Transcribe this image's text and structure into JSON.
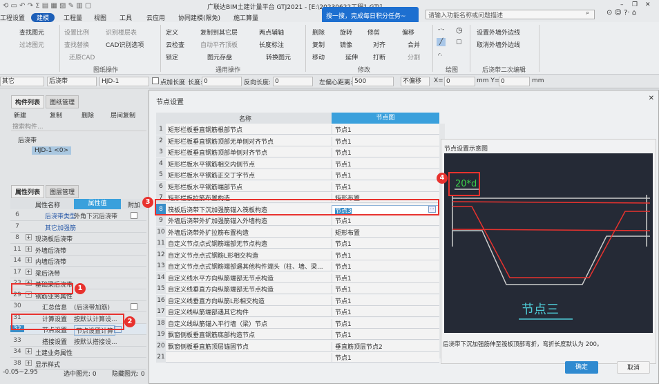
{
  "app": {
    "title": "广联达BIM土建计量平台 GTJ2021 - [E:\\20230622工程1.GTJ]"
  },
  "tabs": [
    "工程设置",
    "建模",
    "工程量",
    "视图",
    "工具",
    "云应用",
    "协同建模(限免)",
    "施工算量"
  ],
  "active_tab": "建模",
  "promo_banner": "搜一搜，完成每日积分任务~",
  "search": {
    "placeholder": "请输入功能名称或问题描述"
  },
  "ribbon": {
    "select_group": [
      "查找图元",
      "过滤图元"
    ],
    "drawing_ops": {
      "items": [
        "设置比例",
        "识别楼层表",
        "查找替换",
        "CAD识别选项",
        "还原CAD"
      ],
      "label": "图纸操作"
    },
    "general_ops": {
      "items": [
        "定义",
        "复制到其它层",
        "两点辅轴",
        "云检查",
        "自动平齐顶板",
        "长度标注",
        "锁定",
        "图元存盘",
        "转换图元"
      ],
      "label": "通用操作"
    },
    "modify": {
      "items": [
        "删除",
        "旋转",
        "修剪",
        "偏移",
        "复制",
        "镜像",
        "对齐",
        "合并",
        "移动",
        "延伸",
        "打断",
        "分割"
      ],
      "label": "修改"
    },
    "draw": {
      "label": "绘图"
    },
    "post_pour": {
      "items": [
        "设置外墙外边线",
        "取消外墙外边线"
      ],
      "label": "后浇带二次编辑"
    }
  },
  "toolbar": {
    "combo1": "其它",
    "combo2": "后浇带",
    "combo3": "HJD-1",
    "add_length": "点加长度",
    "length_label": "长度:",
    "length": "0",
    "rev_label": "反向长度:",
    "rev": "0",
    "offset_label": "左偏心距离:",
    "offset": "500",
    "offset_mode": "不偏移",
    "x_label": "X=",
    "x": "0",
    "y_label": "mm Y=",
    "y": "0",
    "unit": "mm"
  },
  "component_panel": {
    "tabs": [
      "构件列表",
      "图纸管理"
    ],
    "actions": [
      "新建",
      "复制",
      "删除",
      "层间复制"
    ],
    "search_placeholder": "搜索构件...",
    "tree_root": "后浇带",
    "tree_item": "HJD-1 <0>"
  },
  "property_panel": {
    "tabs": [
      "属性列表",
      "图层管理"
    ],
    "headers": [
      "属性名称",
      "属性值",
      "附加"
    ],
    "rows": [
      {
        "n": "6",
        "k": "后浇带类型",
        "v": "外角下沉后浇带",
        "check": true
      },
      {
        "n": "7",
        "k": "其它加强筋",
        "v": ""
      },
      {
        "n": "8",
        "k": "现浇板后浇带",
        "v": "",
        "exp": "+"
      },
      {
        "n": "11",
        "k": "外墙后浇带",
        "v": "",
        "exp": "+"
      },
      {
        "n": "14",
        "k": "内墙后浇带",
        "v": "",
        "exp": "+"
      },
      {
        "n": "17",
        "k": "梁后浇带",
        "v": "",
        "exp": "+"
      },
      {
        "n": "23",
        "k": "基础梁后浇带",
        "v": "",
        "exp": "+"
      },
      {
        "n": "29",
        "k": "钢筋业务属性",
        "v": "",
        "exp": "-"
      },
      {
        "n": "30",
        "k": "汇总信息",
        "v": "(后浇带加筋)",
        "check": true
      },
      {
        "n": "31",
        "k": "计算设置",
        "v": "按默认计算设..."
      },
      {
        "n": "32",
        "k": "节点设置",
        "v": "节点设置计算"
      },
      {
        "n": "33",
        "k": "搭接设置",
        "v": "按默认搭接设..."
      },
      {
        "n": "34",
        "k": "土建业务属性",
        "v": "",
        "exp": "+"
      },
      {
        "n": "38",
        "k": "显示样式",
        "v": "",
        "exp": "+"
      }
    ]
  },
  "status": {
    "range": "-0.05~2.95",
    "selected": "选中图元: 0",
    "hidden": "隐藏图元: 0"
  },
  "dialog": {
    "title": "节点设置",
    "headers": [
      "名称",
      "节点图"
    ],
    "rows": [
      {
        "n": "1",
        "k": "矩形栏板垂直钢筋根部节点",
        "v": "节点1"
      },
      {
        "n": "2",
        "k": "矩形栏板垂直钢筋顶部无单侧对齐节点",
        "v": "节点1"
      },
      {
        "n": "3",
        "k": "矩形栏板垂直钢筋顶部单侧对齐节点",
        "v": "节点1"
      },
      {
        "n": "4",
        "k": "矩形栏板水平钢筋相交内侧节点",
        "v": "节点1"
      },
      {
        "n": "5",
        "k": "矩形栏板水平钢筋正交丁字节点",
        "v": "节点1"
      },
      {
        "n": "6",
        "k": "矩形栏板水平钢筋端部节点",
        "v": "节点1"
      },
      {
        "n": "7",
        "k": "矩形栏板拉筋布置构造",
        "v": "矩形布置"
      },
      {
        "n": "8",
        "k": "筏板后浇带下沉加强筋锚入筏板构造",
        "v": "节点3"
      },
      {
        "n": "9",
        "k": "外墙后浇带外扩加强筋锚入外墙构造",
        "v": "节点1"
      },
      {
        "n": "10",
        "k": "外墙后浇带外扩拉筋布置构造",
        "v": "矩形布置"
      },
      {
        "n": "11",
        "k": "自定义节点点式钢筋端部无节点构造",
        "v": "节点1"
      },
      {
        "n": "12",
        "k": "自定义节点点式钢筋L形相交构造",
        "v": "节点1"
      },
      {
        "n": "13",
        "k": "自定义节点点式钢筋端部遇其他构件端头（柱、墙、梁...",
        "v": "节点1"
      },
      {
        "n": "14",
        "k": "自定义线水平方向纵筋端部无节点构造",
        "v": "节点1"
      },
      {
        "n": "15",
        "k": "自定义线垂直方向纵筋端部无节点构造",
        "v": "节点1"
      },
      {
        "n": "16",
        "k": "自定义线垂直方向纵筋L形相交构造",
        "v": "节点1"
      },
      {
        "n": "17",
        "k": "自定义线纵筋端部遇其它构件",
        "v": "节点1"
      },
      {
        "n": "18",
        "k": "自定义线纵筋锚入平行墙（梁）节点",
        "v": "节点1"
      },
      {
        "n": "19",
        "k": "飘窗侧板垂直钢筋底部构造节点",
        "v": "节点1"
      },
      {
        "n": "20",
        "k": "飘窗侧板垂直筋顶层锚固节点",
        "v": "垂直筋顶层节点2"
      },
      {
        "n": "21",
        "k": "",
        "v": "节点1"
      }
    ],
    "preview_title": "节点设置示意图",
    "dim_label": "20*d",
    "node_name": "节点三",
    "caption": "后浇带下沉加强筋伸至筏板顶部弯折，弯折长度默认为 200。",
    "ok": "确定",
    "cancel": "取消"
  },
  "annotations": [
    "1",
    "2",
    "3",
    "4"
  ],
  "colors": {
    "accent": "#1d5fb8",
    "annotation": "#e8322e",
    "header": "#3aa0dc",
    "rebar": "#e8322e",
    "preview_bg": "#252a36"
  }
}
